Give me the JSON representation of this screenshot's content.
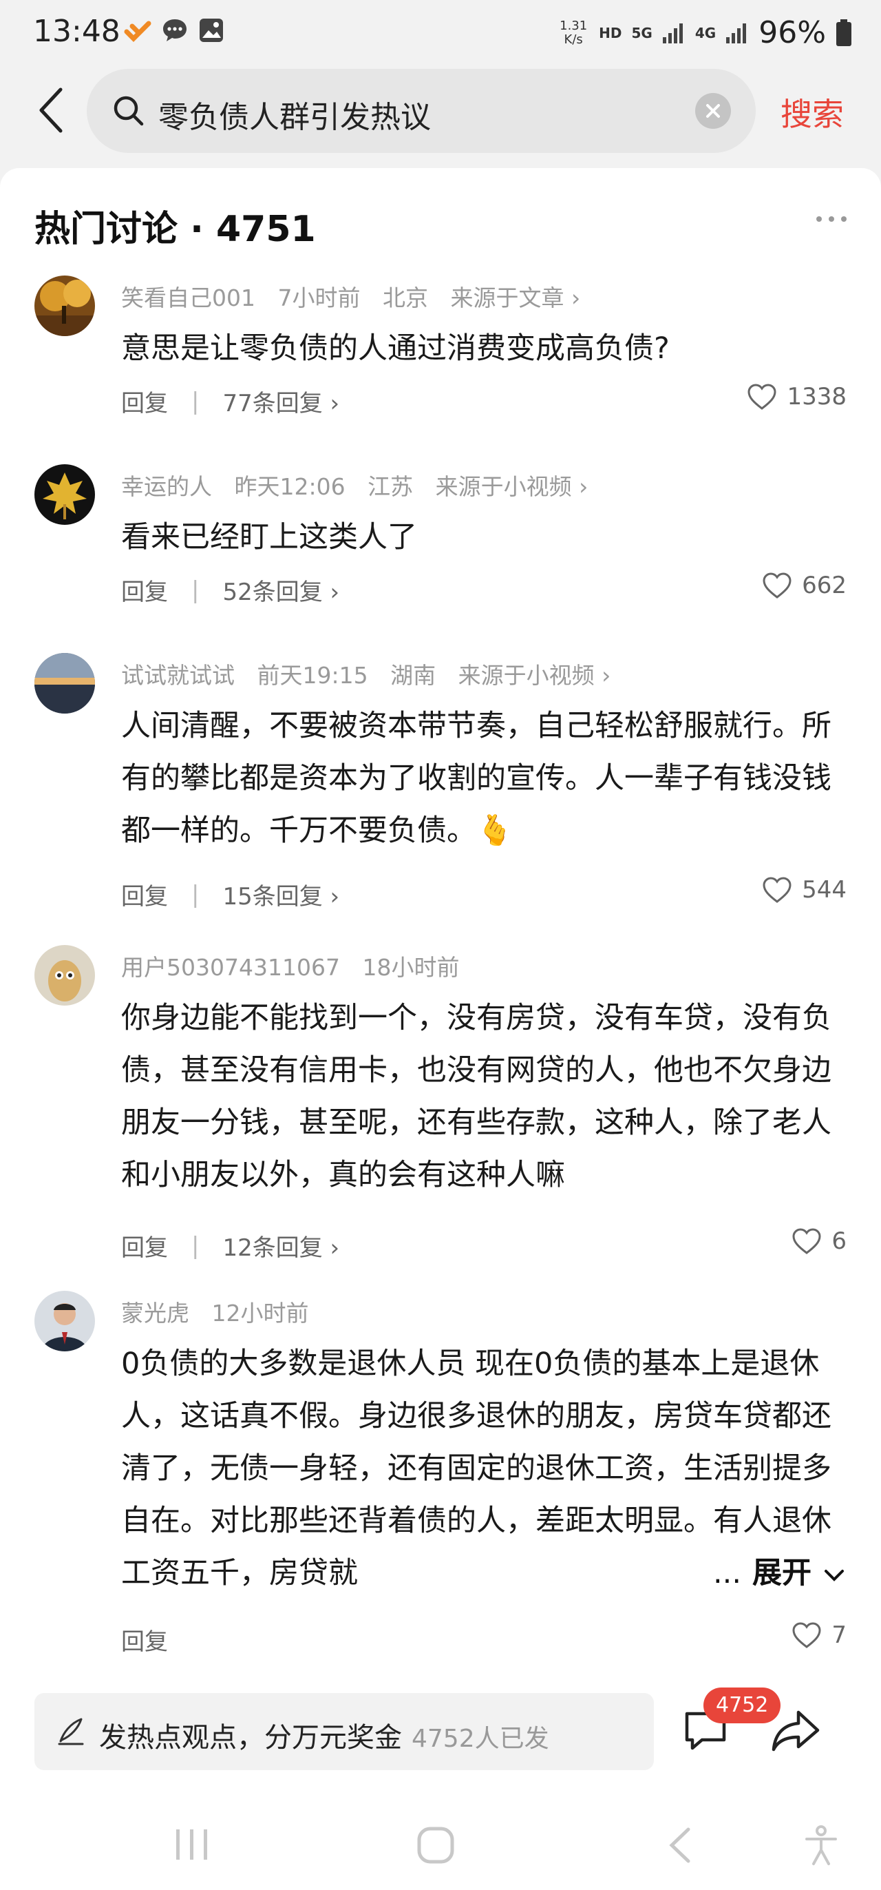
{
  "status_bar": {
    "time": "13:48",
    "speed_value": "1.31",
    "speed_unit": "K/s",
    "hd": "HD",
    "net_5g": "5G",
    "net_4g": "4G",
    "battery": "96%"
  },
  "search": {
    "query": "零负债人群引发热议",
    "button_label": "搜索"
  },
  "section": {
    "title": "热门讨论 · 4751"
  },
  "comments": [
    {
      "user": "笑看自己001",
      "time": "7小时前",
      "location": "北京",
      "source": "来源于文章 ›",
      "text": "意思是让零负债的人通过消费变成高负债?",
      "reply_label": "回复",
      "reply_count": "77条回复 ›",
      "likes": "1338"
    },
    {
      "user": "幸运的人",
      "time": "昨天12:06",
      "location": "江苏",
      "source": "来源于小视频 ›",
      "text": "看来已经盯上这类人了",
      "reply_label": "回复",
      "reply_count": "52条回复 ›",
      "likes": "662"
    },
    {
      "user": "试试就试试",
      "time": "前天19:15",
      "location": "湖南",
      "source": "来源于小视频 ›",
      "text": "人间清醒，不要被资本带节奏，自己轻松舒服就行。所有的攀比都是资本为了收割的宣传。人一辈子有钱没钱都一样的。千万不要负债。🫰",
      "reply_label": "回复",
      "reply_count": "15条回复 ›",
      "likes": "544"
    },
    {
      "user": "用户503074311067",
      "time": "18小时前",
      "text": "你身边能不能找到一个，没有房贷，没有车贷，没有负债，甚至没有信用卡，也没有网贷的人，他也不欠身边朋友一分钱，甚至呢，还有些存款，这种人，除了老人和小朋友以外，真的会有这种人嘛",
      "reply_label": "回复",
      "reply_count": "12条回复 ›",
      "likes": "6"
    },
    {
      "user": "蒙光虎",
      "time": "12小时前",
      "text": "0负债的大多数是退休人员 现在0负债的基本上是退休人，这话真不假。身边很多退休的朋友，房贷车贷都还清了，无债一身轻，还有固定的退休工资，生活别提多自在。对比那些还背着债的人，差距太明显。有人退休工资五千，房贷就",
      "expand_dots": "...",
      "expand_label": "展开",
      "reply_label": "回复",
      "likes": "7"
    }
  ],
  "bottom_bar": {
    "post_prompt": "发热点观点，分万元奖金",
    "post_count": "4752人已发",
    "comment_badge": "4752"
  },
  "colors": {
    "accent": "#e8453a",
    "meta_gray": "#9a9a9a"
  }
}
